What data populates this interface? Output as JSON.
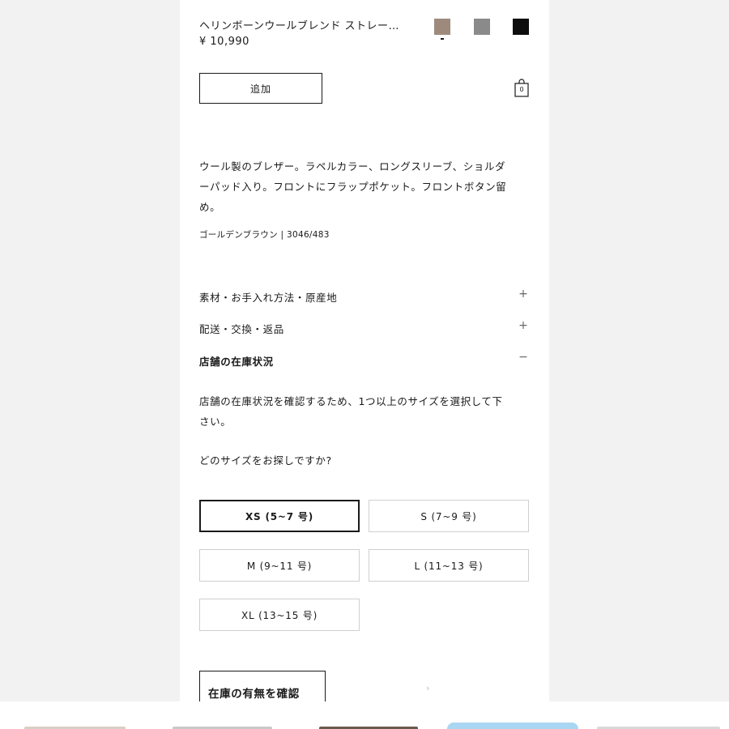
{
  "product": {
    "title": "ヘリンボーンウールブレンド ストレー…",
    "price": "¥ 10,990",
    "colors": [
      {
        "name": "golden-brown",
        "hex": "#9e8a7d",
        "selected": true
      },
      {
        "name": "gray",
        "hex": "#8a8a8a",
        "selected": false
      },
      {
        "name": "black",
        "hex": "#0d0d0d",
        "selected": false
      }
    ],
    "add_label": "追加",
    "bag_count": "0",
    "description_lines": [
      "ウール製のブレザー。ラペルカラー、ロングスリーブ、ショルダ",
      "ーパッド入り。フロントにフラップポケット。フロントボタン留",
      "め。"
    ],
    "color_code": "ゴールデンブラウン | 3046/483"
  },
  "accordion": [
    {
      "label": "素材・お手入れ方法・原産地",
      "sign": "+",
      "expanded": false
    },
    {
      "label": "配送・交換・返品",
      "sign": "+",
      "expanded": false
    },
    {
      "label": "店舗の在庫状況",
      "sign": "−",
      "expanded": true
    }
  ],
  "stock": {
    "description_lines": [
      "店舗の在庫状況を確認するため、1つ以上のサイズを選択して下",
      "さい。"
    ],
    "question": "どのサイズをお探しですか?",
    "sizes": [
      {
        "label": "XS (5~7 号)",
        "selected": true
      },
      {
        "label": "S (7~9 号)",
        "selected": false
      },
      {
        "label": "M (9~11 号)",
        "selected": false
      },
      {
        "label": "L (11~13 号)",
        "selected": false
      },
      {
        "label": "XL (13~15 号)",
        "selected": false
      }
    ],
    "check_label": "在庫の有無を確認"
  },
  "strip_thumbs": [
    {
      "color": "#d8cfc6"
    },
    {
      "color": "#c9c9c9"
    },
    {
      "color": "#6b5a4e"
    },
    {
      "color": "#a9d6f2"
    },
    {
      "color": "#d9d9d9"
    }
  ]
}
